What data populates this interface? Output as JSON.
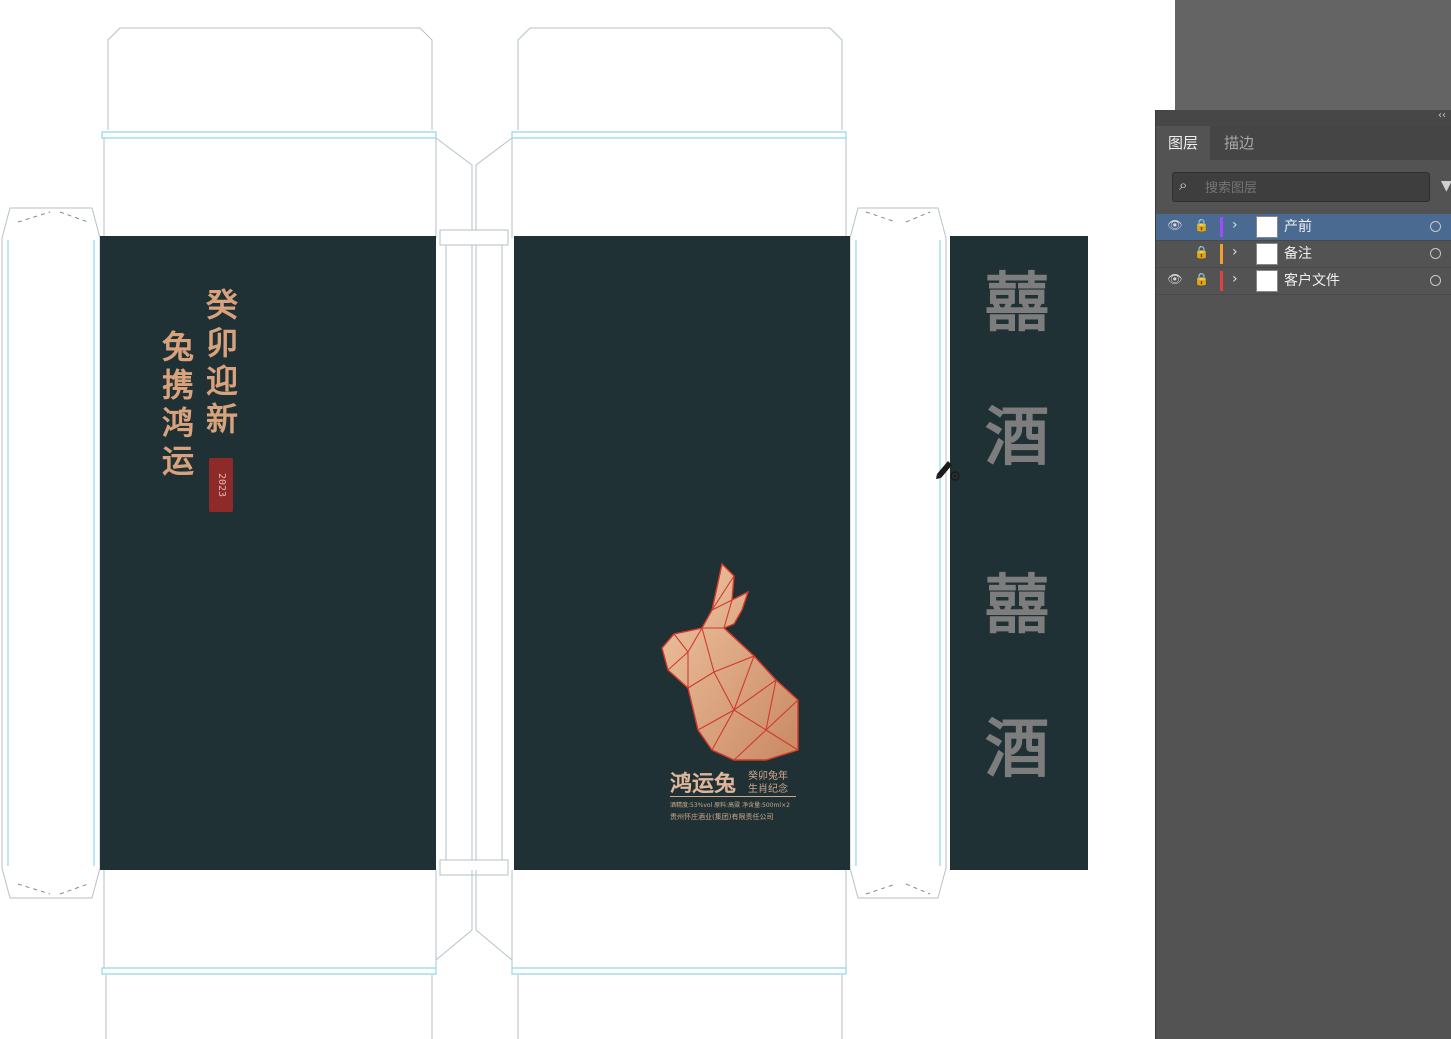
{
  "artboard": {
    "front_vertical_text": {
      "right_column": "癸卯迎新",
      "left_column": "兔携鸿运",
      "seal": "2023"
    },
    "back_label": {
      "brand_name": "鸿运兔",
      "subtitle_line1": "癸卯兔年",
      "subtitle_line2": "生肖纪念",
      "spec_line": "酒精度:53%vol 原料:高粱 净含量:500ml×2",
      "company_line": "贵州怀庄酒业(集团)有限责任公司"
    },
    "side_panel_glyphs": [
      "囍",
      "酒",
      "囍",
      "酒"
    ],
    "colors": {
      "box_dark": "#1f3134",
      "gold": "#d7a27c",
      "seal_red": "#8e2a2a",
      "side_glyph_grey": "#7d7d7d"
    },
    "cursor_icon": "pen-tool-icon"
  },
  "layers_panel": {
    "collapse_label": "‹‹",
    "tabs": [
      {
        "label": "图层",
        "active": true
      },
      {
        "label": "描边",
        "active": false
      }
    ],
    "search": {
      "placeholder": "搜索图层",
      "value": ""
    },
    "filter_icon": "filter-icon",
    "layers": [
      {
        "name": "产前",
        "visible": true,
        "locked": true,
        "color": "#9b4dff",
        "selected": true
      },
      {
        "name": "备注",
        "visible": false,
        "locked": true,
        "color": "#f0a030",
        "selected": false
      },
      {
        "name": "客户文件",
        "visible": true,
        "locked": true,
        "color": "#e04040",
        "selected": false
      }
    ]
  }
}
